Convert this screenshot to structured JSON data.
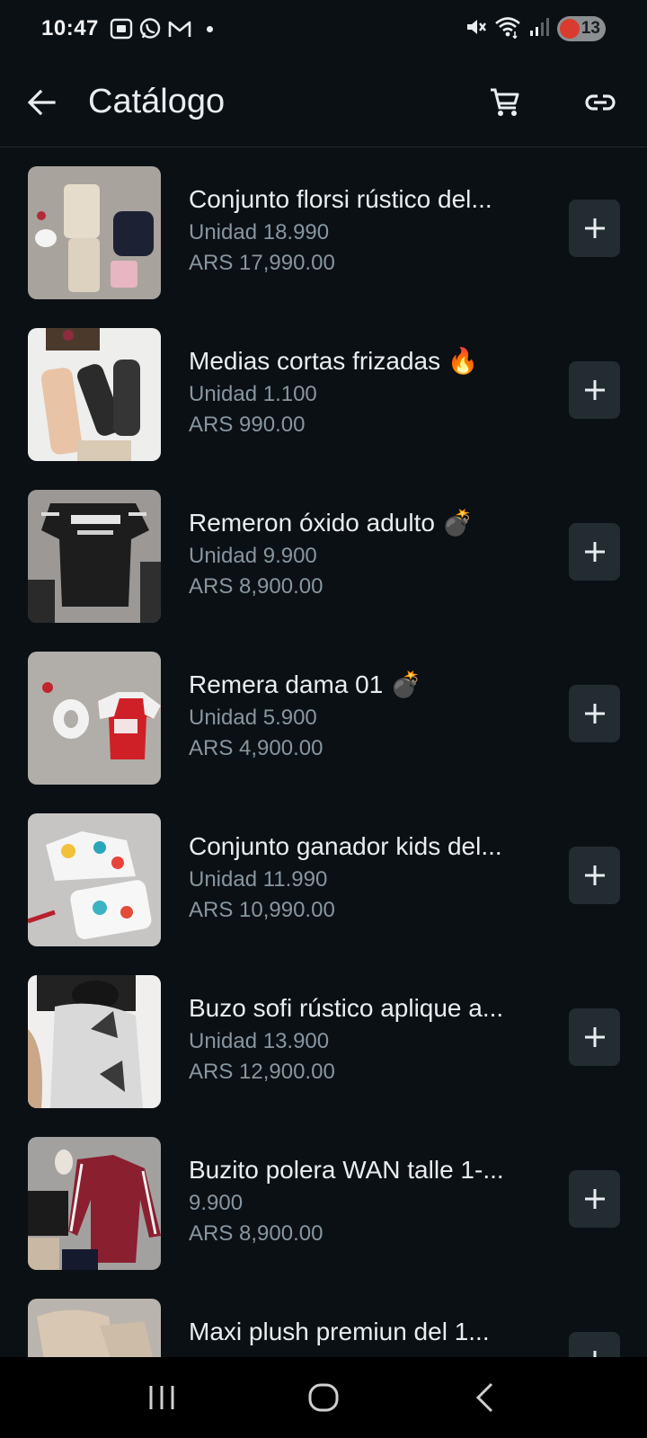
{
  "status_bar": {
    "time": "10:47",
    "battery_level": "13",
    "left_icons": [
      "screenshot-icon",
      "whatsapp-icon",
      "gmail-icon",
      "notification-dot"
    ],
    "right_icons": [
      "mute-icon",
      "wifi-icon",
      "signal-icon",
      "battery-icon"
    ]
  },
  "app_bar": {
    "title": "Catálogo",
    "back_icon": "arrow-left-icon",
    "cart_icon": "cart-icon",
    "link_icon": "link-icon"
  },
  "products": [
    {
      "name": "Conjunto florsi rústico del...",
      "unit": "Unidad 18.990",
      "price": "ARS 17,990.00"
    },
    {
      "name": "Medias cortas frizadas 🔥",
      "unit": "Unidad 1.100",
      "price": "ARS 990.00"
    },
    {
      "name": "Remeron óxido adulto 💣",
      "unit": "Unidad 9.900",
      "price": "ARS 8,900.00"
    },
    {
      "name": "Remera dama 01 💣",
      "unit": "Unidad 5.900",
      "price": "ARS 4,900.00"
    },
    {
      "name": "Conjunto ganador kids del...",
      "unit": "Unidad 11.990",
      "price": "ARS 10,990.00"
    },
    {
      "name": "Buzo sofi rústico aplique a...",
      "unit": "Unidad 13.900",
      "price": "ARS 12,900.00"
    },
    {
      "name": "Buzito polera WAN talle 1-...",
      "unit": "9.900",
      "price": "ARS 8,900.00"
    },
    {
      "name": "Maxi plush premiun del 1...",
      "unit": "",
      "price": ""
    }
  ],
  "colors": {
    "background": "#0b1014",
    "text_primary": "#e9edef",
    "text_secondary": "#8696a0",
    "button_bg": "#232c31"
  }
}
